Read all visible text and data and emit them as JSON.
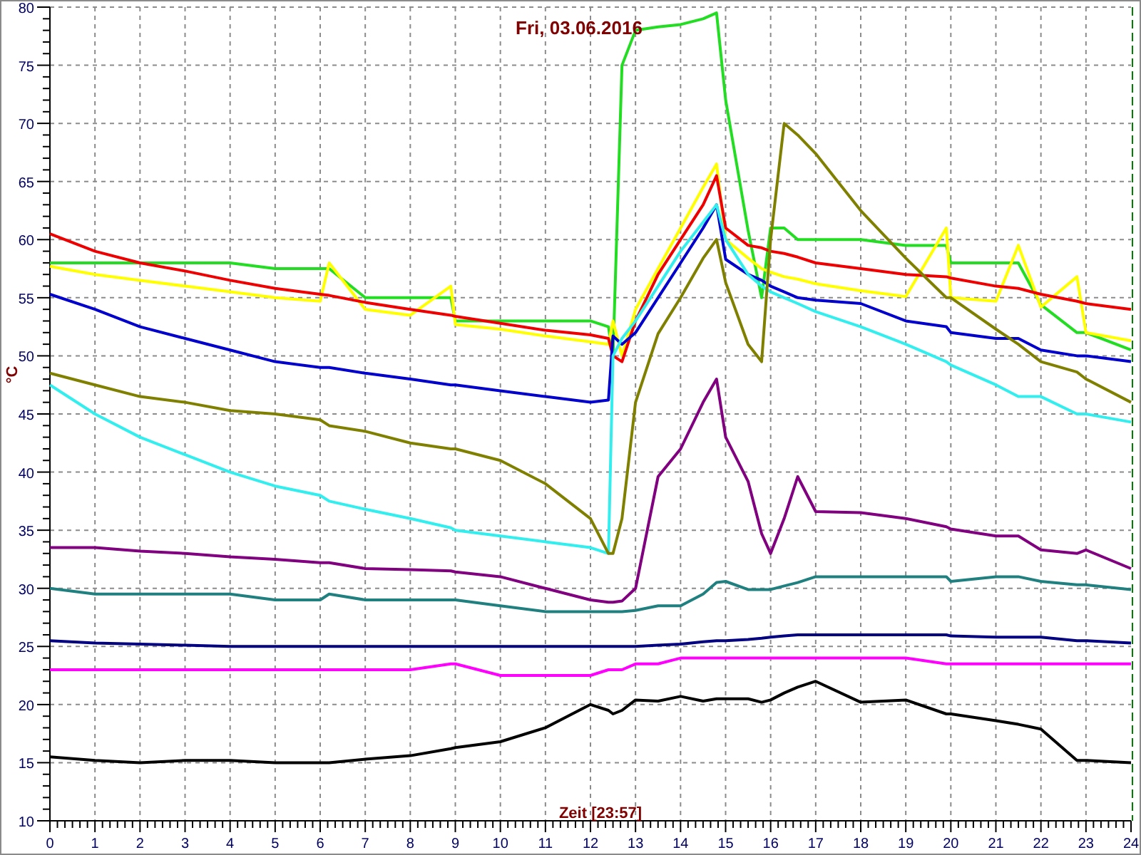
{
  "chart": {
    "chart_data": {
      "type": "line",
      "title": "Fri, 03.06.2016",
      "xlabel": "Zeit [23:57]",
      "ylabel": "°C",
      "x": [
        0,
        1,
        2,
        3,
        4,
        5,
        6,
        6.2,
        7,
        8,
        8.9,
        9,
        10,
        11,
        12,
        12.4,
        12.5,
        12.7,
        13,
        13.5,
        14,
        14.5,
        14.8,
        15,
        15.5,
        15.8,
        16,
        16.3,
        16.6,
        17,
        18,
        19,
        19.9,
        20,
        21,
        21.5,
        22,
        22.8,
        23,
        24
      ],
      "series": [
        {
          "color": "#22dd22",
          "values": [
            58,
            58,
            58,
            58,
            58,
            57.5,
            57.5,
            57.5,
            55,
            55,
            55,
            53,
            53,
            53,
            53,
            52.5,
            50,
            75,
            78,
            78.3,
            78.5,
            79,
            79.5,
            72,
            60.8,
            55,
            61,
            61,
            60,
            60,
            60,
            59.5,
            59.5,
            58,
            58,
            58,
            54.4,
            52,
            52,
            50.5
          ]
        },
        {
          "color": "#ffff00",
          "values": [
            57.7,
            57,
            56.5,
            56,
            55.5,
            55,
            54.7,
            58,
            54,
            53.5,
            56,
            52.7,
            52.3,
            51.7,
            51.2,
            51,
            53,
            50,
            54,
            57.5,
            61,
            64.5,
            66.5,
            60,
            58.4,
            57.5,
            57.2,
            56.8,
            56.6,
            56.2,
            55.6,
            55.1,
            61,
            55,
            54.7,
            59.5,
            54.2,
            56.8,
            52,
            51.3
          ]
        },
        {
          "color": "#ee0000",
          "values": [
            60.5,
            59,
            58,
            57.3,
            56.5,
            55.8,
            55.3,
            55.2,
            54.6,
            54,
            53.5,
            53.4,
            52.8,
            52.2,
            51.8,
            51.5,
            50,
            49.5,
            53,
            57,
            60,
            63,
            65.5,
            61,
            59.5,
            59.3,
            59,
            58.8,
            58.5,
            58,
            57.5,
            57,
            56.8,
            56.7,
            56,
            55.8,
            55.3,
            54.7,
            54.5,
            54
          ]
        },
        {
          "color": "#0000cc",
          "values": [
            55.3,
            54,
            52.5,
            51.5,
            50.5,
            49.5,
            49,
            49,
            48.5,
            48,
            47.5,
            47.5,
            47,
            46.5,
            46,
            46.2,
            51.7,
            51,
            52,
            55,
            58,
            61,
            63,
            58.3,
            57,
            56.5,
            56,
            55.5,
            55,
            54.8,
            54.5,
            53,
            52.5,
            52,
            51.5,
            51.5,
            50.5,
            50,
            50,
            49.5
          ]
        },
        {
          "color": "#33eeee",
          "values": [
            47.5,
            45,
            43,
            41.5,
            40,
            38.8,
            38,
            37.5,
            36.8,
            36,
            35.2,
            35,
            34.5,
            34,
            33.5,
            33,
            50,
            51.5,
            53,
            56,
            59,
            61.5,
            63,
            60,
            57,
            56,
            55.5,
            55,
            54.5,
            53.8,
            52.5,
            51,
            49.5,
            49.2,
            47.5,
            46.5,
            46.5,
            45,
            45,
            44.3
          ]
        },
        {
          "color": "#808000",
          "values": [
            48.5,
            47.5,
            46.5,
            46,
            45.3,
            45,
            44.5,
            44,
            43.5,
            42.5,
            42,
            42,
            41,
            39,
            36,
            33,
            33,
            36,
            46,
            51.9,
            55,
            58.4,
            60,
            56.3,
            51,
            49.5,
            60,
            70,
            69,
            67.4,
            62.5,
            58.4,
            55,
            55,
            52.3,
            51,
            49.5,
            48.6,
            48,
            46
          ]
        },
        {
          "color": "#800080",
          "values": [
            33.5,
            33.5,
            33.2,
            33,
            32.7,
            32.5,
            32.2,
            32.2,
            31.7,
            31.6,
            31.5,
            31.4,
            31,
            30,
            29,
            28.8,
            28.8,
            28.9,
            30,
            39.6,
            42,
            46,
            48,
            43,
            39.2,
            34.7,
            33,
            36,
            39.6,
            36.6,
            36.5,
            36,
            35.3,
            35.1,
            34.5,
            34.5,
            33.3,
            33,
            33.3,
            31.7
          ]
        },
        {
          "color": "#208080",
          "values": [
            30,
            29.5,
            29.5,
            29.5,
            29.5,
            29,
            29,
            29.5,
            29,
            29,
            29,
            29,
            28.5,
            28,
            28,
            28,
            28,
            28,
            28.1,
            28.5,
            28.5,
            29.5,
            30.5,
            30.6,
            29.9,
            29.9,
            29.9,
            30.2,
            30.5,
            31,
            31,
            31,
            31,
            30.6,
            31,
            31,
            30.6,
            30.3,
            30.3,
            29.9
          ]
        },
        {
          "color": "#000080",
          "values": [
            25.5,
            25.3,
            25.2,
            25.1,
            25,
            25,
            25,
            25,
            25,
            25,
            25,
            25,
            25,
            25,
            25,
            25,
            25,
            25,
            25,
            25.1,
            25.2,
            25.4,
            25.5,
            25.5,
            25.6,
            25.7,
            25.8,
            25.9,
            26,
            26,
            26,
            26,
            26,
            25.9,
            25.8,
            25.8,
            25.8,
            25.5,
            25.5,
            25.3
          ]
        },
        {
          "color": "#ff00ff",
          "values": [
            23,
            23,
            23,
            23,
            23,
            23,
            23,
            23,
            23,
            23,
            23.5,
            23.5,
            22.5,
            22.5,
            22.5,
            23,
            23,
            23,
            23.5,
            23.5,
            24,
            24,
            24,
            24,
            24,
            24,
            24,
            24,
            24,
            24,
            24,
            24,
            23.5,
            23.5,
            23.5,
            23.5,
            23.5,
            23.5,
            23.5,
            23.5
          ]
        },
        {
          "color": "#000000",
          "values": [
            15.5,
            15.2,
            15,
            15.2,
            15.2,
            15,
            15,
            15,
            15.3,
            15.6,
            16.2,
            16.3,
            16.8,
            18,
            20,
            19.5,
            19.2,
            19.5,
            20.4,
            20.3,
            20.7,
            20.3,
            20.5,
            20.5,
            20.5,
            20.2,
            20.4,
            21,
            21.5,
            22,
            20.2,
            20.4,
            19.2,
            19.2,
            18.6,
            18.3,
            17.9,
            15.2,
            15.2,
            15
          ]
        }
      ],
      "xlim": [
        0,
        24
      ],
      "ylim": [
        10,
        80
      ],
      "xticks": [
        0,
        1,
        2,
        3,
        4,
        5,
        6,
        7,
        8,
        9,
        10,
        11,
        12,
        13,
        14,
        15,
        16,
        17,
        18,
        19,
        20,
        21,
        22,
        23,
        24
      ],
      "yticks": [
        10,
        15,
        20,
        25,
        30,
        35,
        40,
        45,
        50,
        55,
        60,
        65,
        70,
        75,
        80
      ],
      "grid": true
    }
  }
}
